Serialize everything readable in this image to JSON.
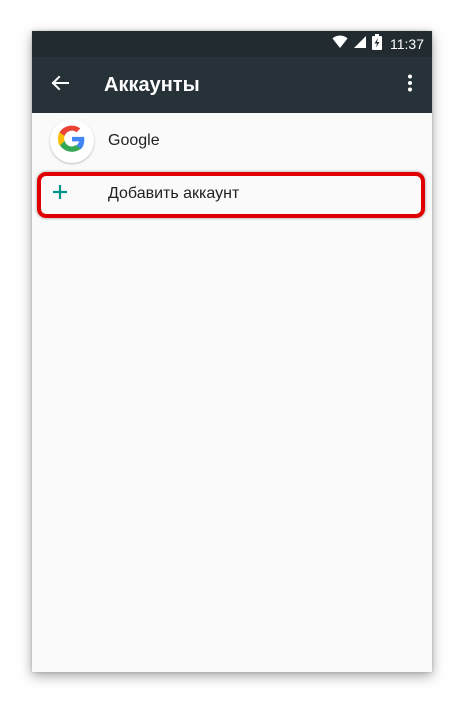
{
  "status_bar": {
    "time": "11:37",
    "icons": [
      "wifi-icon",
      "signal-icon",
      "battery-charging-icon"
    ]
  },
  "toolbar": {
    "title": "Аккаунты",
    "back_icon": "arrow-left-icon",
    "menu_icon": "more-vertical-icon"
  },
  "accounts": [
    {
      "label": "Google",
      "icon": "google-logo-icon"
    }
  ],
  "add_account": {
    "label": "Добавить аккаунт",
    "icon": "plus-icon"
  },
  "colors": {
    "toolbar": "#263238",
    "status_bar": "#222b30",
    "background": "#fafafa",
    "accent_plus": "#009688",
    "highlight": "#e00000"
  }
}
